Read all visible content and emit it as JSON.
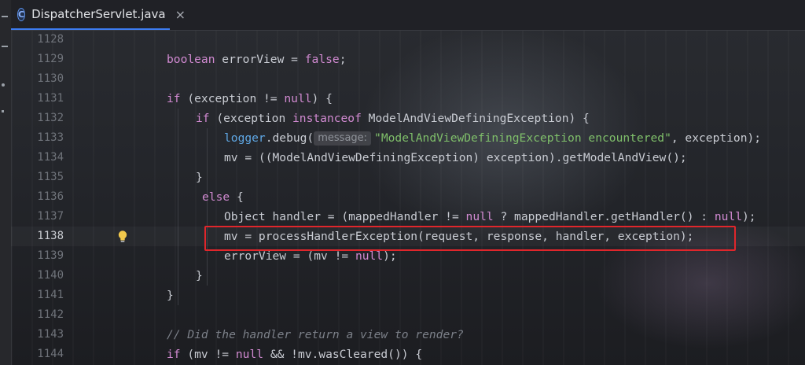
{
  "tab": {
    "icon_letter": "C",
    "title": "DispatcherServlet.java",
    "close": "×"
  },
  "hint_label": "message:",
  "lines": [
    {
      "n": "1128"
    },
    {
      "n": "1129"
    },
    {
      "n": "1130"
    },
    {
      "n": "1131"
    },
    {
      "n": "1132"
    },
    {
      "n": "1133"
    },
    {
      "n": "1134"
    },
    {
      "n": "1135"
    },
    {
      "n": "1136"
    },
    {
      "n": "1137"
    },
    {
      "n": "1138"
    },
    {
      "n": "1139"
    },
    {
      "n": "1140"
    },
    {
      "n": "1141"
    },
    {
      "n": "1142"
    },
    {
      "n": "1143"
    },
    {
      "n": "1144"
    }
  ],
  "code": {
    "l1129": {
      "kw1": "boolean",
      "a": " errorView = ",
      "kw2": "false",
      "b": ";"
    },
    "l1131": {
      "kw1": "if",
      "a": " (exception != ",
      "kw2": "null",
      "b": ") {"
    },
    "l1132": {
      "kw1": "if",
      "a": " (exception ",
      "kw2": "instanceof",
      "b": " ModelAndViewDefiningException) {"
    },
    "l1133": {
      "obj": "logger",
      "dot": ".debug(",
      "str": "\"ModelAndViewDefiningException encountered\"",
      "b": ", exception);"
    },
    "l1134": {
      "a": "mv = ((ModelAndViewDefiningException) exception).getModelAndView();"
    },
    "l1135": {
      "a": "}"
    },
    "l1136": {
      "kw1": "else",
      "a": " {"
    },
    "l1137": {
      "a": "Object handler = (mappedHandler != ",
      "kw1": "null",
      "b": " ? mappedHandler.getHandler() : ",
      "kw2": "null",
      "c": ");"
    },
    "l1138": {
      "a": "mv = processHandlerException(request, response, handler, exception);"
    },
    "l1139": {
      "a": "errorView = (mv != ",
      "kw1": "null",
      "b": ");"
    },
    "l1140": {
      "a": "}"
    },
    "l1141": {
      "a": "}"
    },
    "l1143": {
      "a": "// Did the handler return a view to render?"
    },
    "l1144": {
      "kw1": "if",
      "a": " (mv != ",
      "kw2": "null",
      "b": " && !mv.wasCleared()) {"
    }
  },
  "colors": {
    "keyword": "#d18ad1",
    "method": "#5fa8e6",
    "string": "#7fbf6a",
    "highlight_box": "#e0262b",
    "tab_accent": "#3d7cf0"
  },
  "icons": {
    "tab_icon": "java-class-icon",
    "gutter_icon": "lightbulb-icon"
  }
}
